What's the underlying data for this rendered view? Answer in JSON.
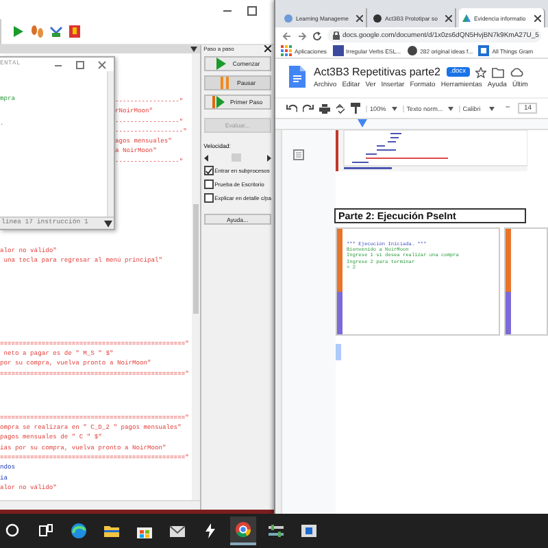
{
  "pseint": {
    "run_window": {
      "title": "ENTAL",
      "output": [
        {
          "text": "mpra",
          "kind": "green"
        },
        {
          "text": ".",
          "kind": "green"
        }
      ],
      "status": "línea 17 instrucción 1"
    },
    "editor_side_lines": [
      {
        "text": "-----------------\"",
        "kind": "string"
      },
      {
        "text": "rNoirMoon\"",
        "kind": "string"
      },
      {
        "text": "-----------------\"",
        "kind": "string"
      },
      {
        "text": "------------------\"",
        "kind": "string"
      },
      {
        "text": "agos mensuales\"",
        "kind": "string"
      },
      {
        "text": "a NoirMoon\"",
        "kind": "string"
      },
      {
        "text": "-----------------\"",
        "kind": "string"
      }
    ],
    "editor_blocks": [
      [
        {
          "text": "alor no válido\"",
          "kind": "string"
        },
        {
          "text": " una tecla para regresar al menú principal\"",
          "kind": "string"
        }
      ],
      [
        {
          "text": "=================================================\"",
          "kind": "string"
        },
        {
          "text": " neto a pagar es de \" M_S \" $\"",
          "kind": "string"
        },
        {
          "text": "por su compra, vuelva pronto a NoirMoon\"",
          "kind": "string"
        },
        {
          "text": "=================================================\"",
          "kind": "string"
        }
      ],
      [
        {
          "text": "=================================================\"",
          "kind": "string"
        },
        {
          "text": "ompra se realizara en \" C_D_2 \" pagos mensuales\"",
          "kind": "string"
        },
        {
          "text": "pagos mensuales de \" C \" $\"",
          "kind": "string"
        },
        {
          "text": "ias por su compra, vuelva pronto a NoirMoon\"",
          "kind": "string"
        },
        {
          "text": "=================================================\"",
          "kind": "string"
        },
        {
          "text": "ndos",
          "kind": "keyword"
        },
        {
          "text": "ia",
          "kind": "keyword"
        }
      ],
      [
        {
          "text": "alor no válido\"",
          "kind": "string"
        }
      ]
    ],
    "step_panel": {
      "title": "Paso a paso",
      "buttons": [
        {
          "label": "Comenzar",
          "kind": "start",
          "disabled": false
        },
        {
          "label": "Pausar",
          "kind": "pause",
          "disabled": false
        },
        {
          "label": "Primer Paso",
          "kind": "step",
          "disabled": false
        },
        {
          "label": "Evaluar...",
          "kind": "plain",
          "disabled": true
        }
      ],
      "speed_label": "Velocidad:",
      "speed": {
        "level": 0.5
      },
      "options": [
        {
          "label": "Entrar en subprocesos",
          "checked": true
        },
        {
          "label": "Prueba de Escritorio",
          "checked": false
        },
        {
          "label": "Explicar en detalle c/pa",
          "checked": false
        }
      ],
      "help_button": "Ayuda..."
    }
  },
  "browser": {
    "tabs": [
      {
        "title": "Learning Manageme",
        "selected": false
      },
      {
        "title": "Act3B3 Prototipar so",
        "selected": false
      },
      {
        "title": "Evidencia informatio",
        "selected": true
      }
    ],
    "url": "docs.google.com/document/d/1x0zs6dQN5HvjBN7k9KmA27U_5",
    "bookmarks": [
      "Aplicaciones",
      "Irregular Verbs ESL...",
      "282 original ideas f...",
      "All Things Gram"
    ],
    "doc": {
      "title": "Act3B3 Repetitivas parte2",
      "badge": ".docx",
      "menu": [
        "Archivo",
        "Editar",
        "Ver",
        "Insertar",
        "Formato",
        "Herramientas",
        "Ayuda",
        "Últim"
      ],
      "toolbar": {
        "zoom": "100%",
        "style": "Texto norm...",
        "font": "Calibri",
        "minus": "−",
        "size": "14"
      },
      "heading": "Parte 2: Ejecución PseInt",
      "console_lines": [
        {
          "text": "*** Ejecución Iniciada. ***",
          "kind": "info"
        },
        {
          "text": "Bienvenido a NoirMoon",
          "kind": "out"
        },
        {
          "text": "Ingrese 1 si desea realizar una compra",
          "kind": "out"
        },
        {
          "text": "Ingrese 2 para terminar",
          "kind": "out"
        },
        {
          "text": "> 2",
          "kind": "out"
        }
      ]
    }
  }
}
